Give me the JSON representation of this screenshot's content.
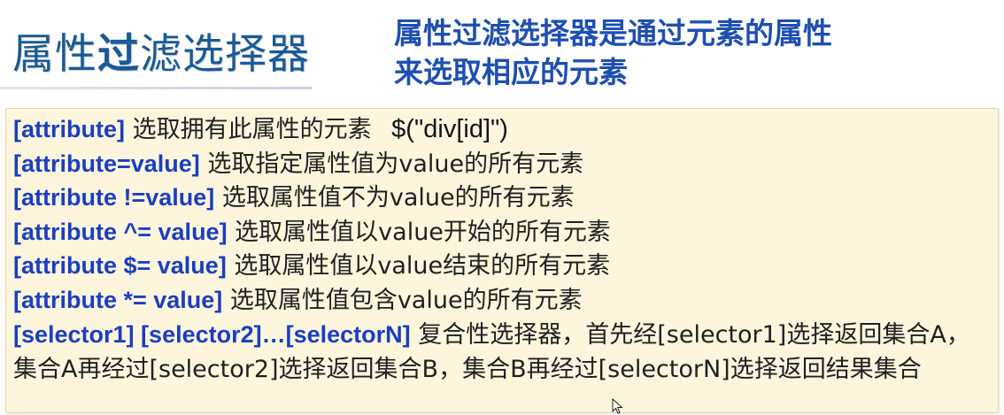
{
  "header": {
    "title_part1": "属性",
    "title_part2": "过",
    "title_part3": "滤选择器",
    "subtitle_line1": "属性过滤选择器是通过元素的属性",
    "subtitle_line2": "来选取相应的元素"
  },
  "selectors": [
    {
      "selector": "[attribute]",
      "description": "选取拥有此属性的元素",
      "example": "$(\"div[id]\")"
    },
    {
      "selector": "[attribute=value]",
      "description": "选取指定属性值为value的所有元素"
    },
    {
      "selector": "[attribute !=value]",
      "description": "选取属性值不为value的所有元素"
    },
    {
      "selector": "[attribute ^= value]",
      "description": "选取属性值以value开始的所有元素"
    },
    {
      "selector": "[attribute $= value]",
      "description": "选取属性值以value结束的所有元素"
    },
    {
      "selector": "[attribute *= value]",
      "description": "选取属性值包含value的所有元素"
    }
  ],
  "composite": {
    "selector": "[selector1] [selector2]…[selectorN]",
    "description": "复合性选择器，首先经[selector1]选择返回集合A，集合A再经过[selector2]选择返回集合B，集合B再经过[selectorN]选择返回结果集合"
  },
  "colors": {
    "title": "#1a5a96",
    "subtitle": "#1e4fb0",
    "selector": "#1c3ec0",
    "box_background": "#fdf6dd"
  },
  "icons": {
    "cursor": "mouse-pointer-icon"
  }
}
